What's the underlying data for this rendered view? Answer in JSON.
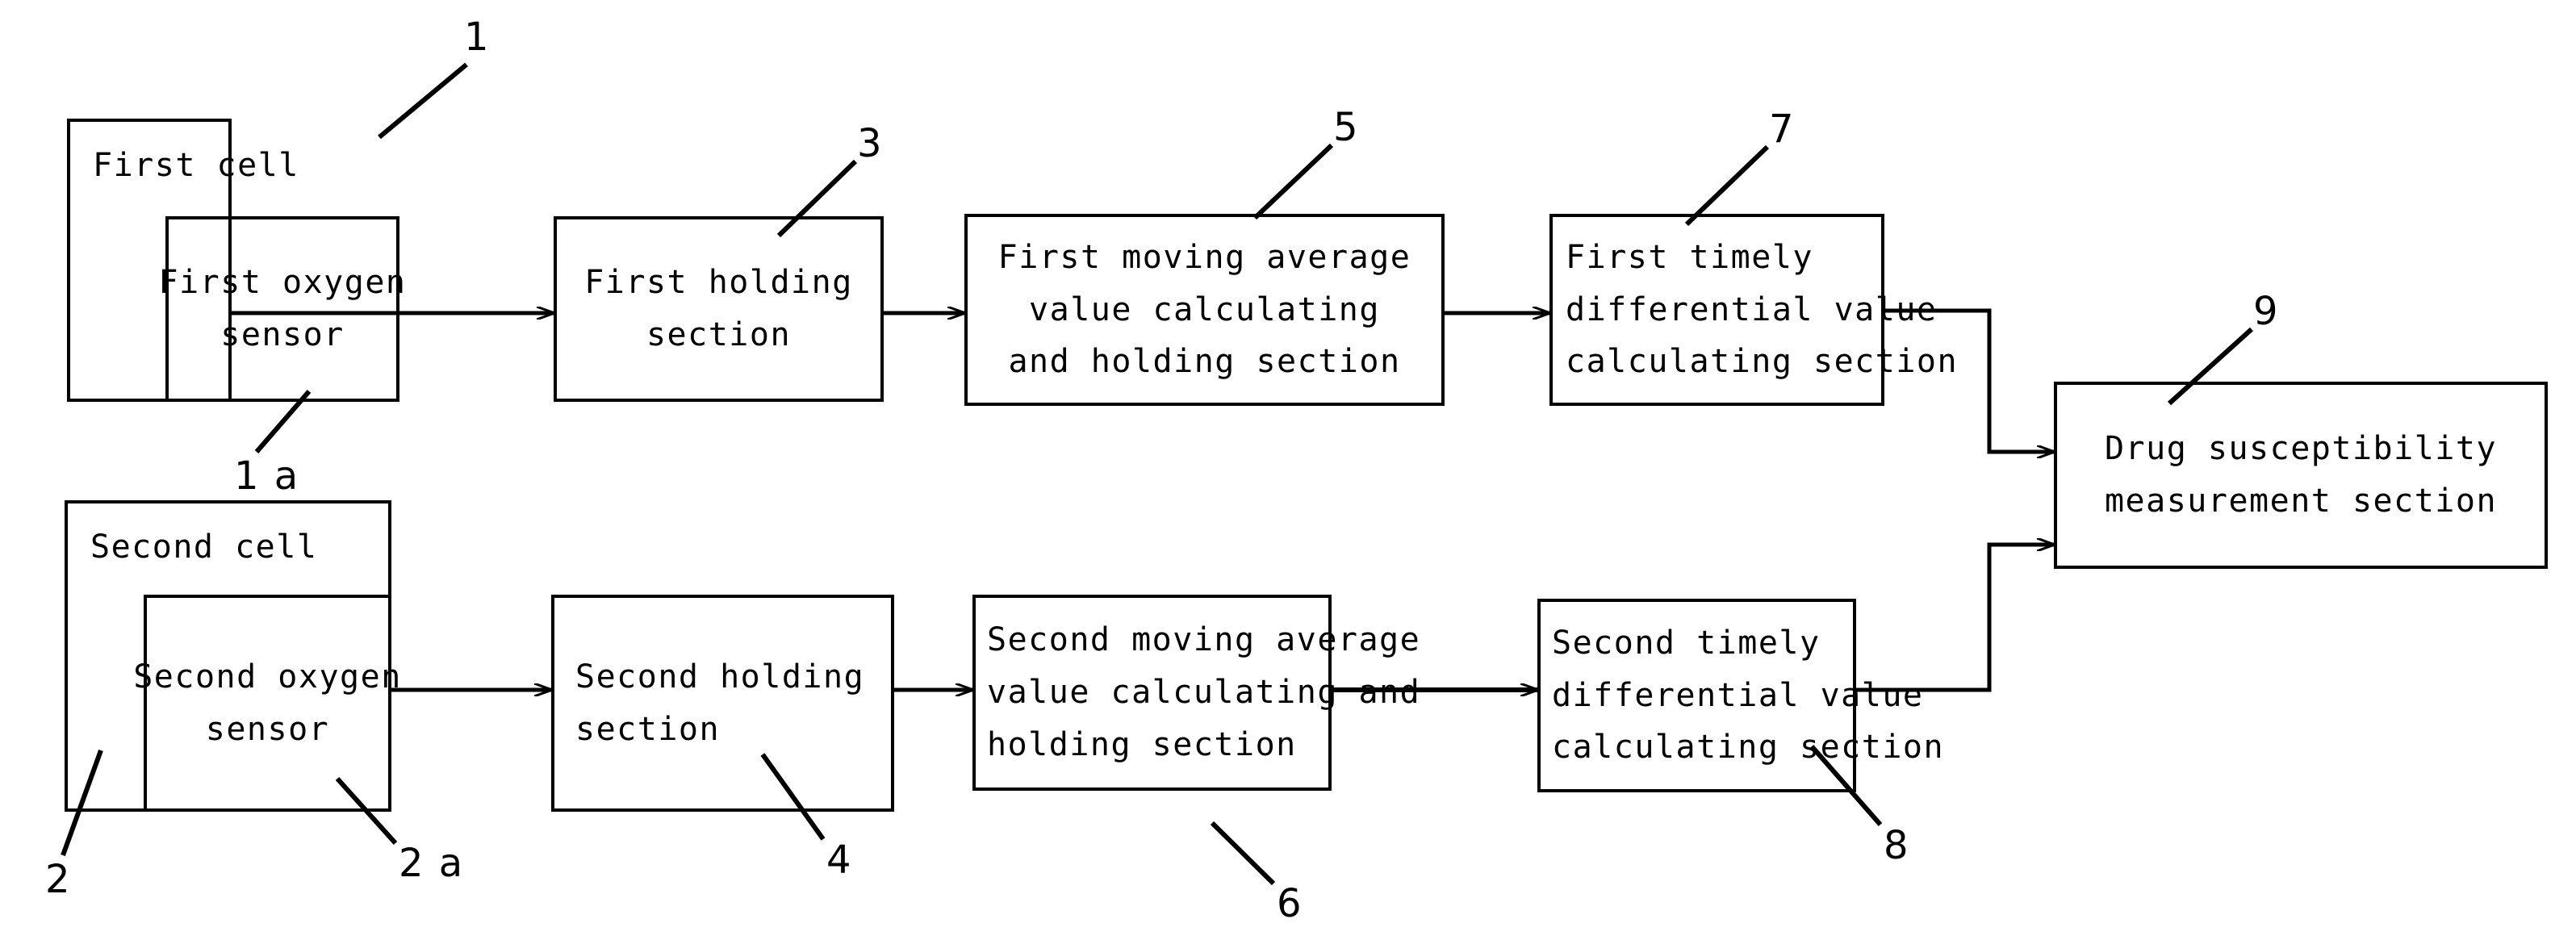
{
  "figure": {
    "type": "patent-block-diagram",
    "background": "#ffffff",
    "ink_color": "#000000"
  },
  "boxes": {
    "first_cell": {
      "label": "First cell",
      "ref": "1"
    },
    "first_oxygen_sensor": {
      "line1": "First oxygen",
      "line2": "sensor",
      "ref": "1 a"
    },
    "first_holding": {
      "line1": "First holding",
      "line2": "section",
      "ref": "3"
    },
    "first_moving_average": {
      "line1": "First moving average",
      "line2": "value calculating",
      "line3": "and holding section",
      "ref": "5"
    },
    "first_timely_diff": {
      "line1": "First timely",
      "line2": "differential value",
      "line3": "calculating section",
      "ref": "7"
    },
    "second_cell": {
      "label": "Second cell",
      "ref": "2"
    },
    "second_oxygen_sensor": {
      "line1": "Second oxygen",
      "line2": "sensor",
      "ref": "2 a"
    },
    "second_holding": {
      "line1": "Second holding",
      "line2": "section",
      "ref": "4"
    },
    "second_moving_average": {
      "line1": "Second moving average",
      "line2": "value calculating and",
      "line3": "holding section",
      "ref": "6"
    },
    "second_timely_diff": {
      "line1": "Second timely",
      "line2": "differential value",
      "line3": "calculating section",
      "ref": "8"
    },
    "drug_susceptibility": {
      "line1": "Drug susceptibility",
      "line2": "measurement section",
      "ref": "9"
    }
  },
  "reference_numerals": [
    {
      "id": "ref-1",
      "text": "1"
    },
    {
      "id": "ref-1a",
      "text": "1 a"
    },
    {
      "id": "ref-2",
      "text": "2"
    },
    {
      "id": "ref-2a",
      "text": "2 a"
    },
    {
      "id": "ref-3",
      "text": "3"
    },
    {
      "id": "ref-4",
      "text": "4"
    },
    {
      "id": "ref-5",
      "text": "5"
    },
    {
      "id": "ref-6",
      "text": "6"
    },
    {
      "id": "ref-7",
      "text": "7"
    },
    {
      "id": "ref-8",
      "text": "8"
    },
    {
      "id": "ref-9",
      "text": "9"
    }
  ],
  "connections": [
    {
      "from": "first_oxygen_sensor",
      "to": "first_holding"
    },
    {
      "from": "first_holding",
      "to": "first_moving_average"
    },
    {
      "from": "first_moving_average",
      "to": "first_timely_diff"
    },
    {
      "from": "first_timely_diff",
      "to": "drug_susceptibility"
    },
    {
      "from": "second_oxygen_sensor",
      "to": "second_holding"
    },
    {
      "from": "second_holding",
      "to": "second_moving_average"
    },
    {
      "from": "second_moving_average",
      "to": "second_timely_diff"
    },
    {
      "from": "second_timely_diff",
      "to": "drug_susceptibility"
    }
  ]
}
